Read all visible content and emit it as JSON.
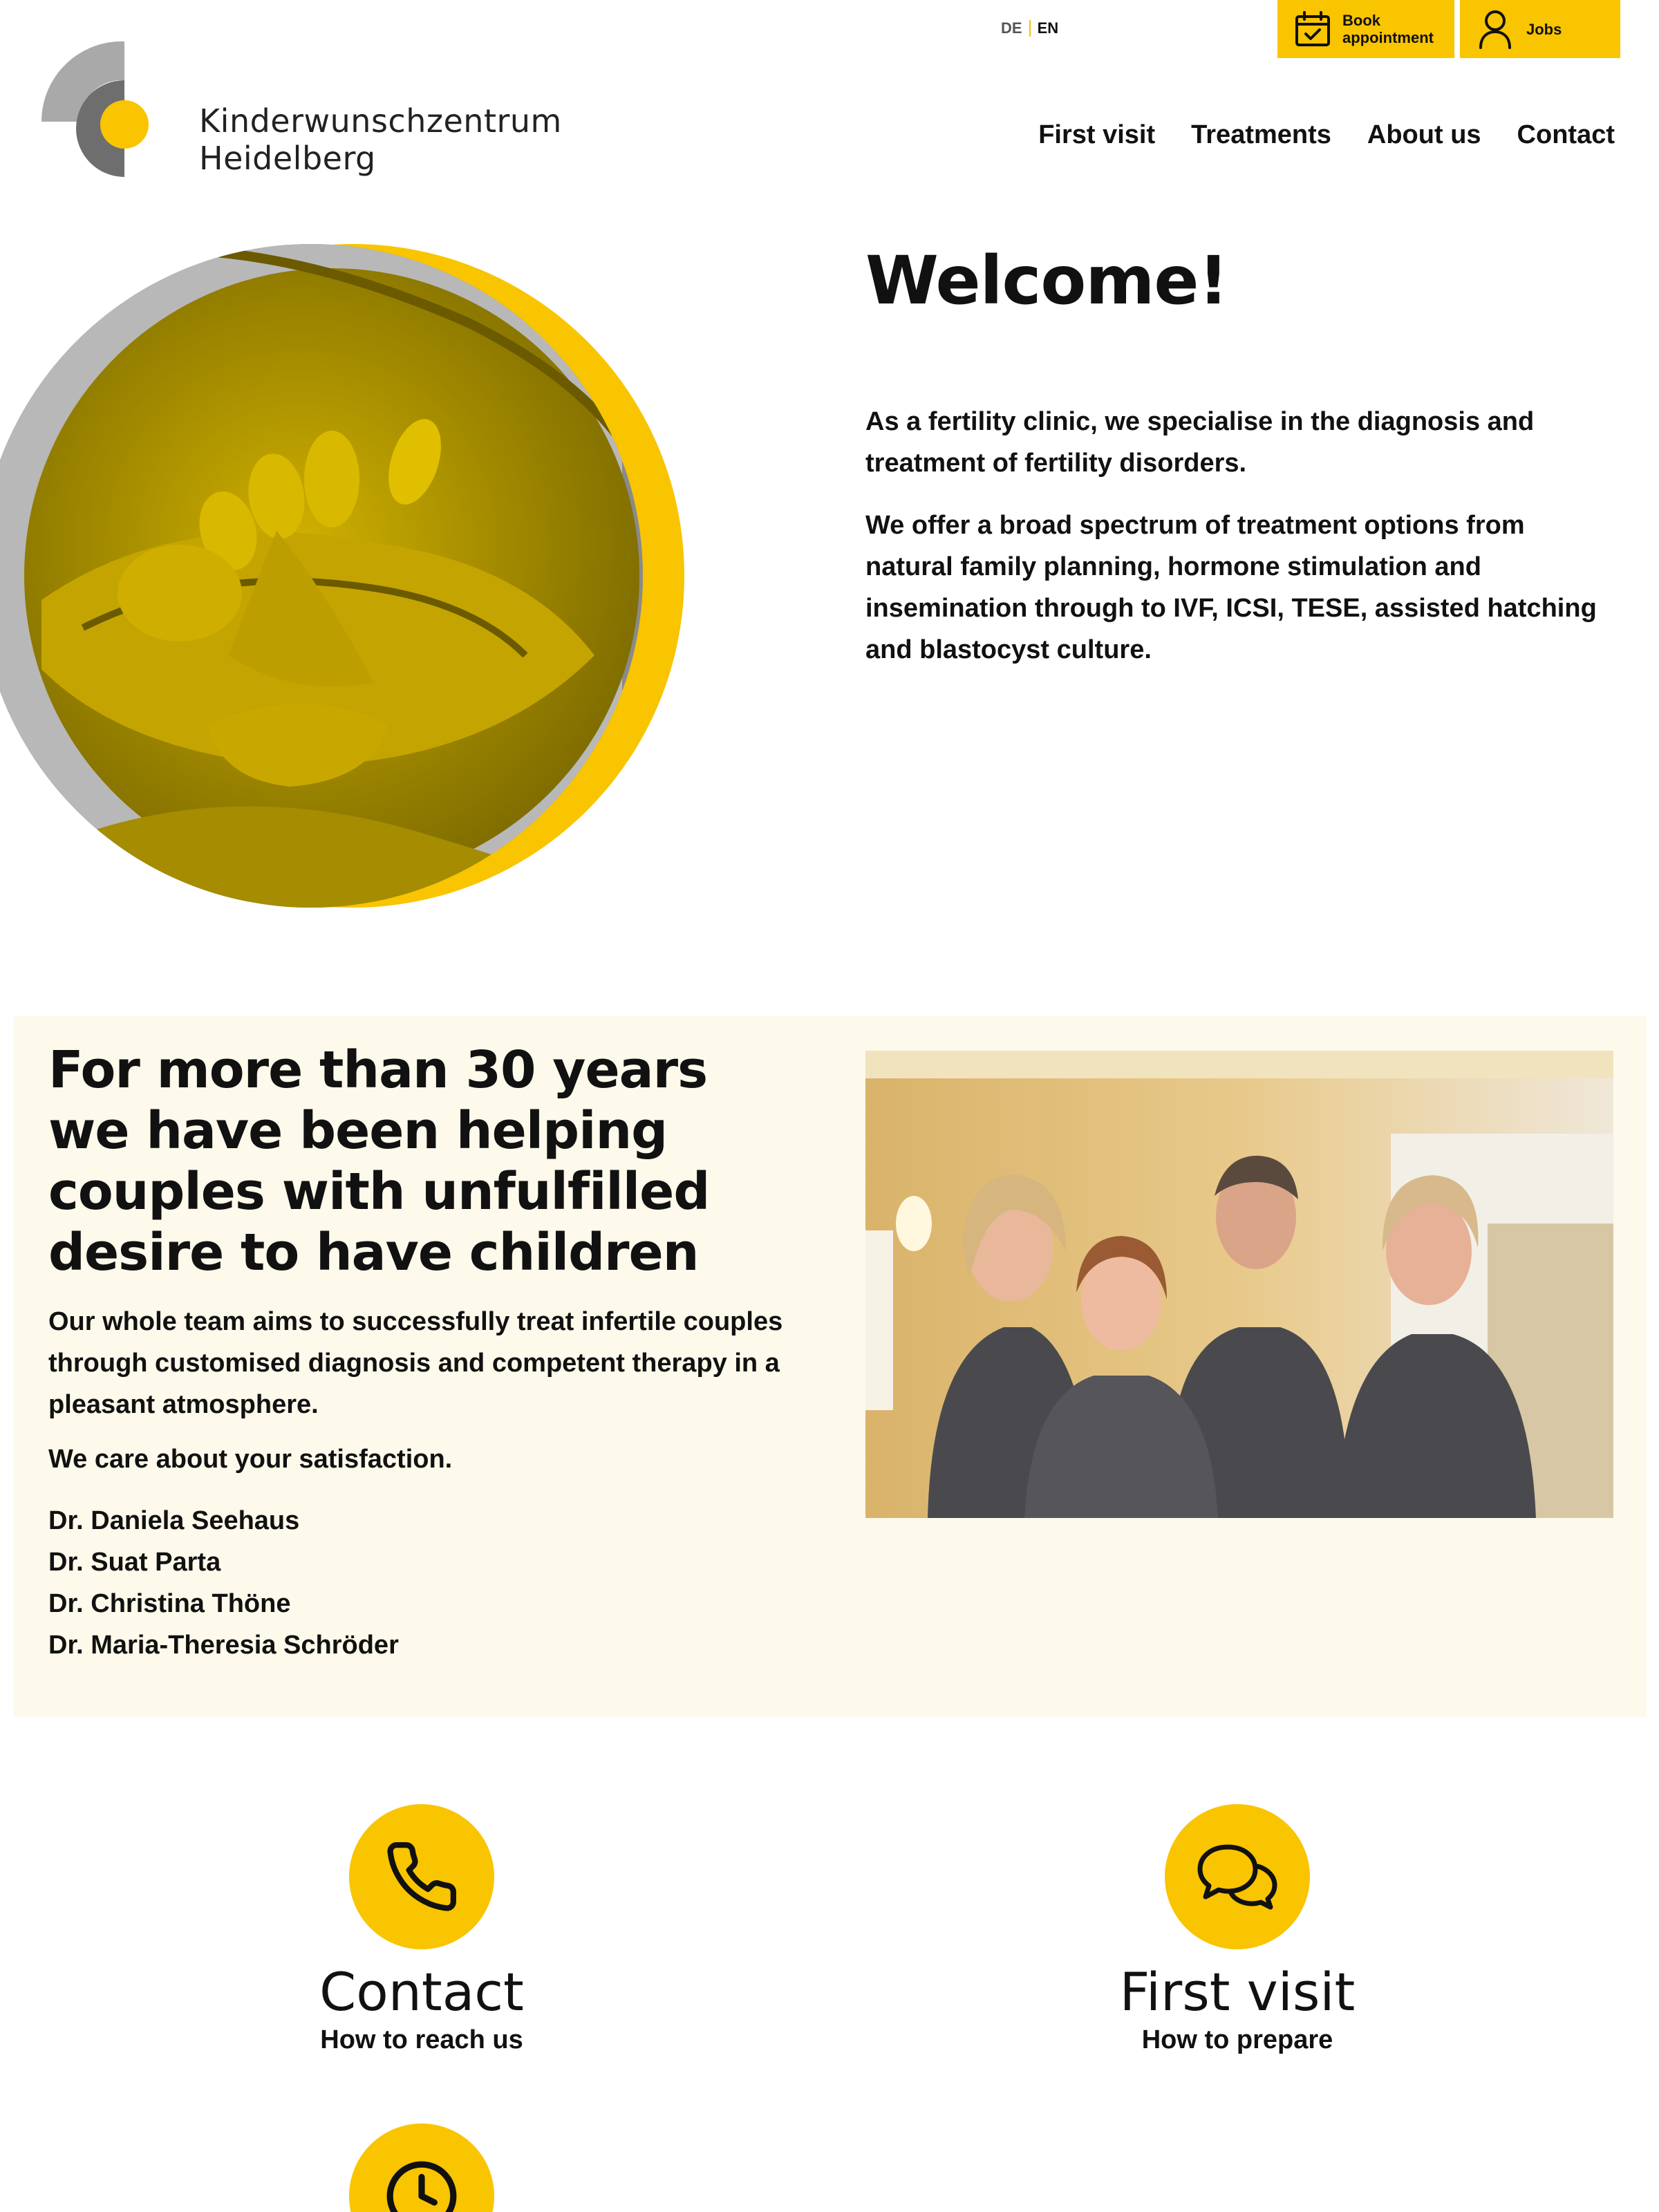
{
  "header": {
    "languages": {
      "de": "DE",
      "en": "EN"
    },
    "book_button": {
      "line1": "Book",
      "line2": "appointment",
      "icon": "calendar-check-icon"
    },
    "jobs_button": {
      "label": "Jobs",
      "icon": "user-icon"
    },
    "logo": {
      "line1": "Kinderwunschzentrum",
      "line2": "Heidelberg"
    },
    "nav": [
      "First visit",
      "Treatments",
      "About us",
      "Contact"
    ]
  },
  "hero": {
    "title": "Welcome!",
    "paragraphs": [
      "As a fertility clinic, we specialise in the diagnosis and treatment of fertility disorders.",
      "We offer a broad spectrum of treatment options from natural family planning, hormone stimulation and insemination through to IVF, ICSI, TESE, assisted hatching and blastocyst culture."
    ]
  },
  "team": {
    "title_lines": [
      "For more than 30 years",
      "we have been helping",
      "couples with unfulfilled",
      "desire to have children"
    ],
    "lead": "Our whole team aims to successfully treat infertile couples through customised diagnosis and competent therapy in a pleasant atmosphere.",
    "care": "We care about your satisfaction.",
    "doctors": [
      "Dr. Daniela Seehaus",
      "Dr. Suat Parta",
      "Dr. Christina Thöne",
      "Dr. Maria-Theresia Schröder"
    ]
  },
  "features": [
    {
      "title": "Contact",
      "subtitle": "How to reach us",
      "icon": "phone-icon"
    },
    {
      "title": "First visit",
      "subtitle": "How to prepare",
      "icon": "chat-bubbles-icon"
    },
    {
      "title": "",
      "subtitle": "",
      "icon": "clock-icon"
    }
  ],
  "colors": {
    "accent": "#f9c400",
    "band": "#fdf9eb",
    "text": "#111111"
  }
}
